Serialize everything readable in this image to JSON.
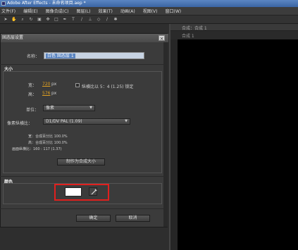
{
  "window": {
    "title": "Adobe After Effects - 未命名项目.aep *"
  },
  "menu": [
    "文件(F)",
    "编辑(E)",
    "图像合成(C)",
    "图层(L)",
    "效果(T)",
    "动画(A)",
    "视图(V)",
    "窗口(W)"
  ],
  "comp_panel": {
    "tab": "合成：合成 1",
    "sub_label": "合成 1"
  },
  "dialog": {
    "title": "固态层设置",
    "close": "×",
    "name_label": "名称：",
    "name_value": "白色 固态层 1",
    "size_group": "大小",
    "width_label": "宽：",
    "width_value": "720",
    "width_unit": "px",
    "height_label": "高：",
    "height_value": "576",
    "height_unit": "px",
    "lock_label": "纵横比以 5：4 (1.25) 锁定",
    "units_label": "单位：",
    "units_value": "像素",
    "pixel_aspect_label": "像素纵横比：",
    "pixel_aspect_value": "D1/DV PAL (1.09)",
    "info_width": "宽：合成百分比 100.0%",
    "info_height": "高：合成百分比 100.0%",
    "info_frame": "画面纵横比：160 : 117 (1.37)",
    "make_comp_size_button": "制作为合成大小",
    "color_group": "颜色",
    "ok_button": "确定",
    "cancel_button": "取消"
  },
  "colors": {
    "swatch": "#ffffff",
    "highlight": "#e0201e"
  },
  "icons": [
    "app-icon",
    "close-icon",
    "eyedropper-icon",
    "dropdown-arrow-icon"
  ]
}
